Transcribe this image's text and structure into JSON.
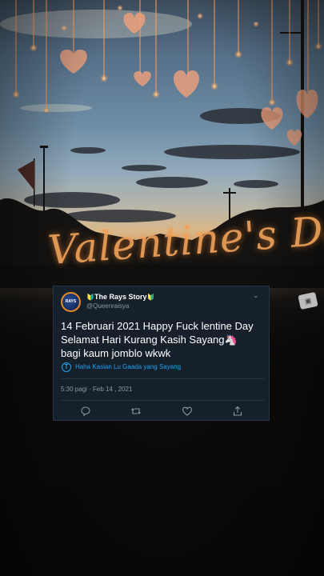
{
  "overlay": {
    "title": "Valentine's Day!"
  },
  "tweet": {
    "display_name": "The Rays Story",
    "name_badge_left": "🔰",
    "name_badge_right": "🔰",
    "avatar_text": "RAYS",
    "handle": "@Queenraisya",
    "text_lines": [
      "14 Februari 2021 Happy Fuck lentine Day",
      "Selamat Hari Kurang Kasih Sayang🦄",
      "bagi kaum jomblo wkwk"
    ],
    "translation_label": "Haha Kasian Lu Gaada yang Sayang",
    "timestamp": "5:30 pagi · Feb 14 , 2021",
    "accent_color": "#1da1f2",
    "card_bg": "#15202b"
  },
  "icons": {
    "more": "chevron-down-icon",
    "translate": "info-circle-icon",
    "reply": "reply-icon",
    "retweet": "retweet-icon",
    "like": "heart-icon",
    "share": "share-icon",
    "sticker": "game-controller-icon"
  }
}
